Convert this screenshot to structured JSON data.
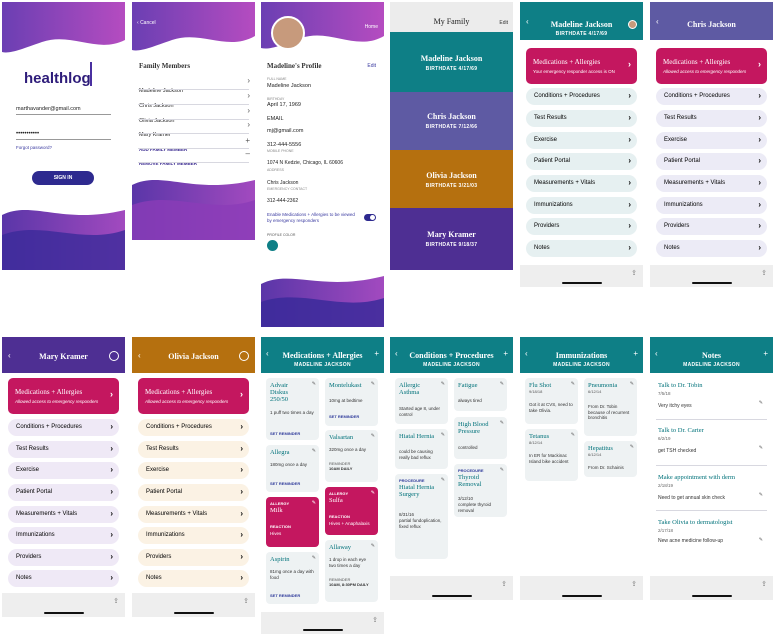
{
  "login": {
    "logo": "healthlog",
    "email": "marthavander@gmail.com",
    "password": "•••••••••••",
    "forgot": "Forgot password?",
    "signin": "SIGN IN"
  },
  "family": {
    "cancel": "Cancel",
    "title": "Family Members",
    "members": [
      "Madeline Jackson",
      "Chris Jackson",
      "Olivia Jackson",
      "Mary Kramer"
    ],
    "add": "ADD FAMILY MEMBER",
    "remove": "REMOVE FAMILY MEMBER"
  },
  "profile": {
    "home": "Home",
    "title": "Madeline's Profile",
    "edit": "Edit",
    "fullname_label": "FULL NAME",
    "fullname": "Madeline Jackson",
    "birthday_label": "BIRTHDAY",
    "birthday": "April 17, 1969",
    "email_label": "EMAIL",
    "email": "mj@gmail.com",
    "phone": "312-444-5556",
    "phone_label": "MOBILE PHONE",
    "address": "1074 N Kedzie, Chicago, IL 60606",
    "address_label": "ADDRESS",
    "ec_name": "Chris Jackson",
    "ec_label": "EMERGENCY CONTACT",
    "ec_phone": "312-444-2362",
    "toggle_text": "Enable Medications + Allergies to be viewed by emergency responders",
    "color_label": "PROFILE COLOR"
  },
  "myfamily": {
    "title": "My Family",
    "edit": "Edit",
    "cards": [
      {
        "name": "Madeline Jackson",
        "bd": "BIRTHDATE 4/17/69",
        "color": "#0e7f86"
      },
      {
        "name": "Chris Jackson",
        "bd": "BIRTHDATE 7/12/66",
        "color": "#5e5aa3"
      },
      {
        "name": "Olivia Jackson",
        "bd": "BIRTHDATE 3/21/03",
        "color": "#b5700f"
      },
      {
        "name": "Mary Kramer",
        "bd": "BIRTHDATE 9/18/37",
        "color": "#4e2f93"
      }
    ]
  },
  "dash": {
    "categories": [
      "Conditions + Procedures",
      "Test Results",
      "Exercise",
      "Patient Portal",
      "Measurements + Vitals",
      "Immunizations",
      "Providers",
      "Notes"
    ],
    "med_title": "Medications + Allergies",
    "madeline": {
      "name": "Madeline Jackson",
      "bd": "BIRTHDATE 4/17/69",
      "sub": "Your emergency responder access is ON"
    },
    "chris": {
      "name": "Chris Jackson",
      "sub": "Allowed access to emergency responders"
    },
    "mary": {
      "name": "Mary Kramer",
      "sub": "Allowed access to emergency responders"
    },
    "olivia": {
      "name": "Olivia Jackson",
      "sub": "Allowed access to emergency responders"
    }
  },
  "meds": {
    "title": "Medications + Allergies",
    "sub": "MADELINE JACKSON",
    "items": [
      {
        "t": "Advair Diskus 250/50",
        "d": "1 puff two times a day",
        "a": "SET REMINDER"
      },
      {
        "t": "Montelukast",
        "d": "10mg at bedtime",
        "a": "SET REMINDER"
      },
      {
        "t": "Valsartan",
        "d": "320mg once a day",
        "r": "REMINDER",
        "rv": "10AM DAILY"
      },
      {
        "t": "Allegra",
        "d": "180mg once a day",
        "a": "SET REMINDER"
      },
      {
        "k": "ALLERGY",
        "t": "Milk",
        "rl": "REACTION",
        "rv": "Hives"
      },
      {
        "k": "ALLERGY",
        "t": "Sulfa",
        "rl": "REACTION",
        "rv": "Hives + Anaphalaxis"
      },
      {
        "t": "Aspirin",
        "d": "81mg once a day with food",
        "a": "SET REMINDER"
      },
      {
        "t": "Allaway",
        "d": "1 drop in each eye two times a day",
        "r": "REMINDER",
        "rv": "10AM, 8:30PM DAILY"
      }
    ]
  },
  "conds": {
    "title": "Conditions + Procedures",
    "sub": "MADELINE JACKSON",
    "items": [
      {
        "t": "Allergic Asthma",
        "d": "Started age 8, under control"
      },
      {
        "t": "Fatigue",
        "d": "always tired"
      },
      {
        "t": "Hiatal Hernia",
        "d": "could be causing really bad reflux"
      },
      {
        "t": "High Blood Pressure",
        "d": "controlled"
      },
      {
        "k": "PROCEDURE",
        "t": "Hiatal Hernia Surgery",
        "date": "8/31/16",
        "d": "partial fundoplication, fixed reflux"
      },
      {
        "k": "PROCEDURE",
        "t": "Thyroid Removal",
        "date": "3/12/10",
        "d": "complete thyroid removal"
      }
    ]
  },
  "immun": {
    "title": "Immunizations",
    "sub": "MADELINE JACKSON",
    "items": [
      {
        "t": "Flu Shot",
        "date": "9/18/18",
        "d": "Got it at CVS, need to take Olivia."
      },
      {
        "t": "Pneumonia",
        "date": "6/12/14",
        "d": "From Dr. Tobin because of recurrent bronchitis"
      },
      {
        "t": "Tetanus",
        "date": "8/12/14",
        "d": "In ER for Mackinac Island bike accident"
      },
      {
        "t": "Hepatitus",
        "date": "6/12/14",
        "d": "From Dr. Schainis"
      }
    ]
  },
  "notes": {
    "title": "Notes",
    "sub": "MADELINE JACKSON",
    "items": [
      {
        "t": "Talk to Dr. Tobin",
        "date": "7/5/18",
        "b": "Very itchy eyes"
      },
      {
        "t": "Talk to Dr. Carter",
        "date": "6/2/19",
        "b": "get TSH checked"
      },
      {
        "t": "Make appointment with derm",
        "date": "2/18/19",
        "b": "Need to get annual skin check"
      },
      {
        "t": "Take Olivia to dermatologist",
        "date": "2/17/18",
        "b": "New acne medicine follow-up"
      }
    ]
  }
}
